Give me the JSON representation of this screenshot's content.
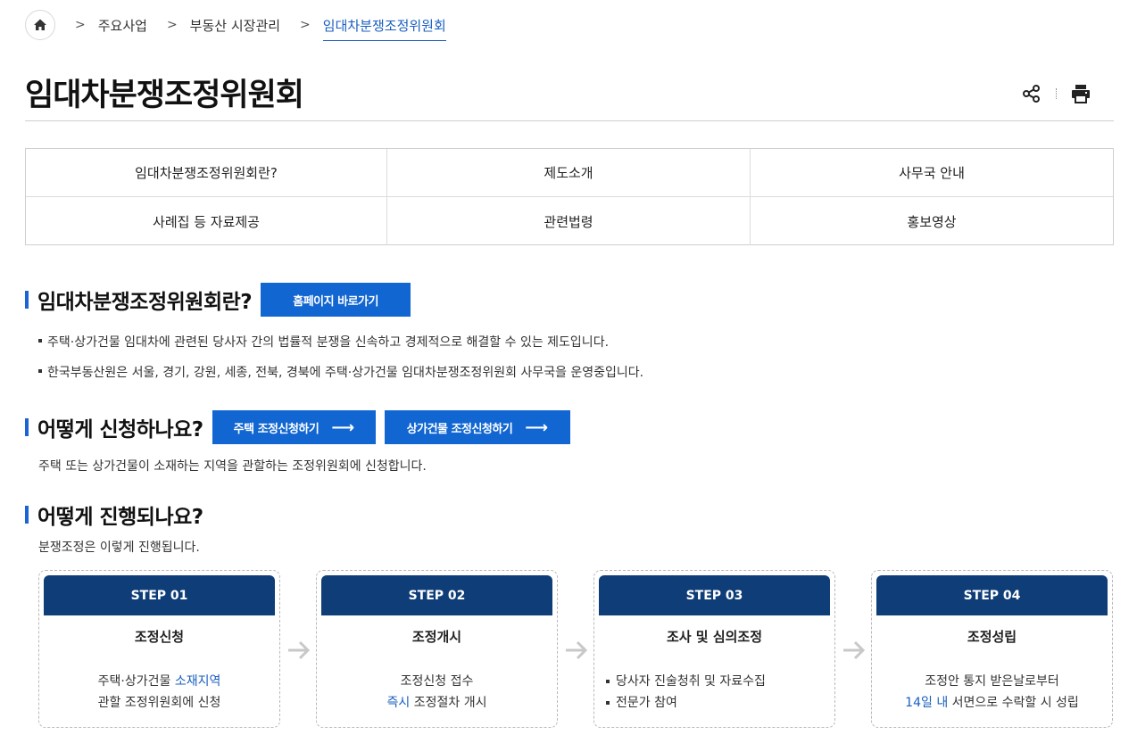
{
  "breadcrumb": {
    "items": [
      "주요사업",
      "부동산 시장관리",
      "임대차분쟁조정위원회"
    ]
  },
  "page_title": "임대차분쟁조정위원회",
  "tabs": [
    "임대차분쟁조정위원회란?",
    "제도소개",
    "사무국 안내",
    "사례집 등 자료제공",
    "관련법령",
    "홍보영상"
  ],
  "section1": {
    "title": "임대차분쟁조정위원회란?",
    "button": "홈페이지 바로가기",
    "bullets": [
      "주택·상가건물 임대차에 관련된 당사자 간의 법률적 분쟁을 신속하고 경제적으로 해결할 수 있는 제도입니다.",
      "한국부동산원은 서울, 경기, 강원, 세종, 전북, 경북에 주택·상가건물 임대차분쟁조정위원회 사무국을 운영중입니다."
    ]
  },
  "section2": {
    "title": "어떻게 신청하나요?",
    "button1": "주택 조정신청하기",
    "button2": "상가건물 조정신청하기",
    "text": "주택 또는 상가건물이 소재하는 지역을 관할하는 조정위원회에 신청합니다."
  },
  "section3": {
    "title": "어떻게 진행되나요?",
    "text": "분쟁조정은 이렇게 진행됩니다."
  },
  "steps": [
    {
      "label": "STEP 01",
      "title": "조정신청",
      "line1_a": "주택·상가건물 ",
      "line1_hl": "소재지역",
      "line2": "관할 조정위원회에 신청"
    },
    {
      "label": "STEP 02",
      "title": "조정개시",
      "line1": "조정신청 접수",
      "line2_hl": "즉시",
      "line2_b": " 조정절차 개시"
    },
    {
      "label": "STEP 03",
      "title": "조사 및 심의조정",
      "items": [
        "당사자 진술청취 및 자료수집",
        "전문가 참여"
      ]
    },
    {
      "label": "STEP 04",
      "title": "조정성립",
      "line1": "조정안 통지 받은날로부터",
      "line2_hl": "14일 내",
      "line2_b": " 서면으로 수락할 시 성립"
    }
  ],
  "colors": {
    "accent": "#1166d1",
    "step_header": "#0f3d78",
    "link": "#1a5fc0"
  }
}
